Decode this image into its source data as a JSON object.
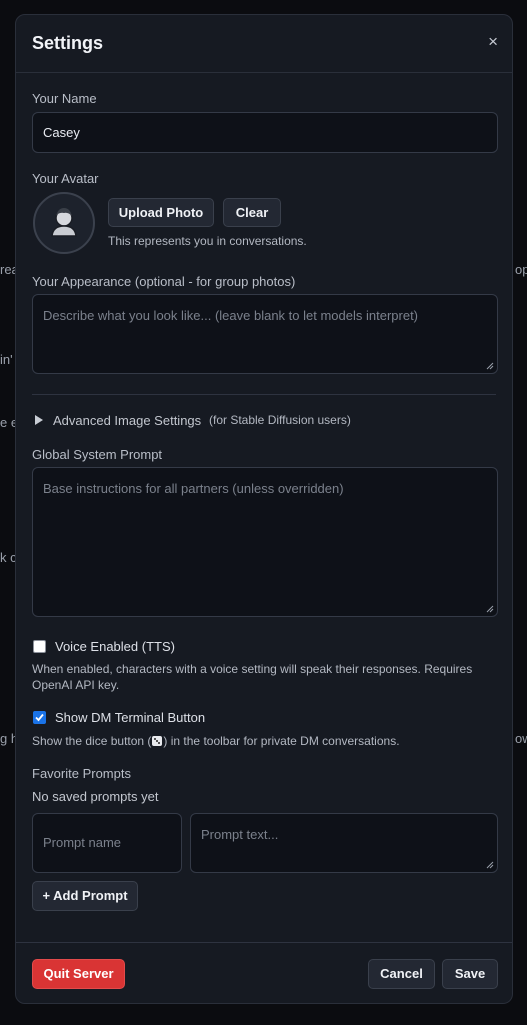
{
  "background": {
    "fragments": [
      "rea",
      "in'",
      "e e",
      "k c",
      "g h",
      "op",
      "ow"
    ]
  },
  "modal": {
    "title": "Settings",
    "close_label": "×"
  },
  "name": {
    "label": "Your Name",
    "value": "Casey"
  },
  "avatar": {
    "label": "Your Avatar",
    "upload_label": "Upload Photo",
    "clear_label": "Clear",
    "hint": "This represents you in conversations.",
    "icon": "person-avatar-icon"
  },
  "appearance": {
    "label": "Your Appearance (optional - for group photos)",
    "placeholder": "Describe what you look like... (leave blank to let models interpret)"
  },
  "advanced": {
    "label": "Advanced Image Settings",
    "note": "(for Stable Diffusion users)",
    "icon": "triangle-right-icon"
  },
  "system_prompt": {
    "label": "Global System Prompt",
    "placeholder": "Base instructions for all partners (unless overridden)"
  },
  "voice": {
    "label": "Voice Enabled (TTS)",
    "checked": false,
    "hint_line1": "When enabled, characters with a voice setting will speak their responses. Requires",
    "hint_line2": "OpenAI API key."
  },
  "dm_terminal": {
    "label": "Show DM Terminal Button",
    "checked": true,
    "hint_before": "Show the dice button (",
    "hint_after": ") in the toolbar for private DM conversations.",
    "icon": "dice-icon"
  },
  "favorites": {
    "label": "Favorite Prompts",
    "empty_text": "No saved prompts yet",
    "name_placeholder": "Prompt name",
    "text_placeholder": "Prompt text...",
    "add_label": "+ Add Prompt"
  },
  "footer": {
    "quit_label": "Quit Server",
    "cancel_label": "Cancel",
    "save_label": "Save"
  },
  "colors": {
    "accent": "#1a73e8",
    "danger": "#d93434",
    "modal_bg": "#161a22",
    "page_bg": "#0b0c10"
  }
}
